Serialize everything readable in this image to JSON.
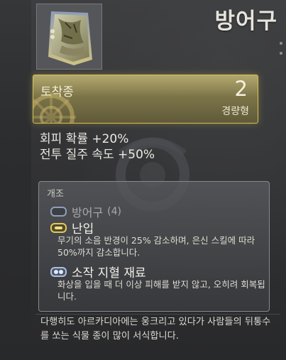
{
  "item": {
    "name": "방어구",
    "type": "토착종",
    "type_value": "2",
    "weight": "경량형"
  },
  "stats": [
    "회피 확률 +20%",
    "전투 질주 속도 +50%"
  ],
  "mods": {
    "header": "개조",
    "slot": {
      "name": "방어구",
      "count": "(4)"
    },
    "entries": [
      {
        "name": "난입",
        "description": "무기의 소음 반경이 25% 감소하며, 은신 스킬에 따라 50%까지 감소합니다."
      },
      {
        "name": "소작 지혈 재료",
        "description": "화상을 입을 때 더 이상 피해를 받지 않고, 오히려 회복됩니다."
      }
    ]
  },
  "flavor_text": "다행히도 아르카디아에는 웅크리고 있다가 사람들의 뒤통수를 쏘는 식물 종이 많이 서식합니다.",
  "colors": {
    "accent_gold": "#d6bf59",
    "background": "#2a2b2d"
  }
}
